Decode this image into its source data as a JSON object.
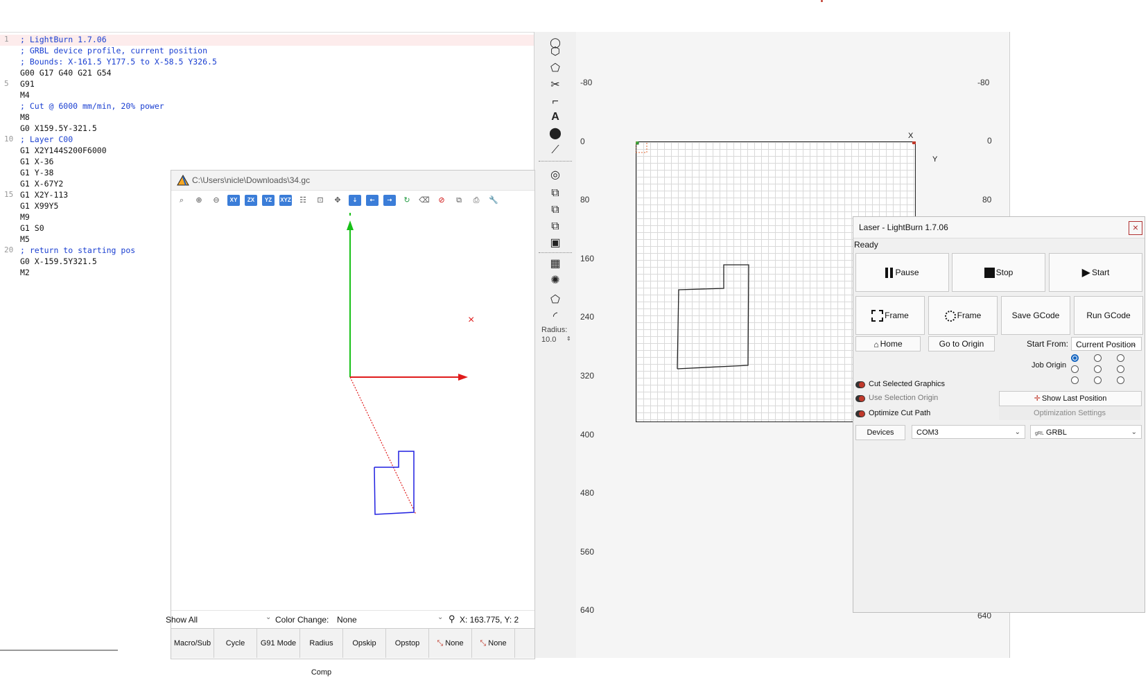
{
  "editor": {
    "lines": [
      {
        "num": "1",
        "text": "; LightBurn 1.7.06",
        "kind": "comment"
      },
      {
        "num": "",
        "text": "; GRBL device profile, current position",
        "kind": "comment"
      },
      {
        "num": "",
        "text": "; Bounds: X-161.5 Y177.5 to X-58.5 Y326.5",
        "kind": "comment"
      },
      {
        "num": "",
        "text": "G00 G17 G40 G21 G54",
        "kind": "plain"
      },
      {
        "num": "5",
        "text": "G91",
        "kind": "plain"
      },
      {
        "num": "",
        "text": "M4",
        "kind": "plain"
      },
      {
        "num": "",
        "text": "; Cut @ 6000 mm/min, 20% power",
        "kind": "comment"
      },
      {
        "num": "",
        "text": "M8",
        "kind": "plain"
      },
      {
        "num": "",
        "text": "G0 X159.5Y-321.5",
        "kind": "plain"
      },
      {
        "num": "10",
        "text": "; Layer C00",
        "kind": "comment"
      },
      {
        "num": "",
        "text": "G1 X2Y144S200F6000",
        "kind": "plain"
      },
      {
        "num": "",
        "text": "G1 X-36",
        "kind": "plain"
      },
      {
        "num": "",
        "text": "G1 Y-38",
        "kind": "plain"
      },
      {
        "num": "",
        "text": "G1 X-67Y2",
        "kind": "plain"
      },
      {
        "num": "15",
        "text": "G1 X2Y-113",
        "kind": "plain"
      },
      {
        "num": "",
        "text": "G1 X99Y5",
        "kind": "plain"
      },
      {
        "num": "",
        "text": "M9",
        "kind": "plain"
      },
      {
        "num": "",
        "text": "G1 S0",
        "kind": "plain"
      },
      {
        "num": "",
        "text": "M5",
        "kind": "plain"
      },
      {
        "num": "20",
        "text": "; return to starting pos",
        "kind": "comment"
      },
      {
        "num": "",
        "text": "G0 X-159.5Y321.5",
        "kind": "plain"
      },
      {
        "num": "",
        "text": "M2",
        "kind": "plain"
      },
      {
        "num": "",
        "text": "",
        "kind": "plain"
      }
    ]
  },
  "viewer": {
    "title": "C:\\Users\\nicle\\Downloads\\34.gc",
    "toolbar": [
      "zoom-100-icon",
      "zoom-in-icon",
      "zoom-out-icon",
      "XY",
      "ZX",
      "YZ",
      "XYZ",
      "tree-icon",
      "fit-icon",
      "pan-icon",
      "move-down-icon",
      "move-left-icon",
      "move-right-icon",
      "refresh-icon",
      "clear-icon",
      "stop-icon",
      "copy-icon",
      "print-icon",
      "wrench-icon"
    ],
    "axis_x_label": "×",
    "show_all": "Show All",
    "color_change_label": "Color Change:",
    "color_change_value": "None",
    "coords": "X: 163.775,  Y: 2",
    "tabs": [
      "Macro/Sub",
      "Cycle",
      "G91 Mode",
      "Radius Comp",
      "Opskip",
      "Opstop",
      "None",
      "None"
    ]
  },
  "tools": {
    "radius_label": "Radius:",
    "radius_value": "10.0"
  },
  "canvas": {
    "left_ruler": [
      "-80",
      "0",
      "80",
      "160",
      "240",
      "320",
      "400",
      "480",
      "560",
      "640"
    ],
    "right_ruler": [
      "-80",
      "0",
      "80",
      "640"
    ],
    "x_marker": "X",
    "y_marker": "Y"
  },
  "laser": {
    "title": "Laser - LightBurn 1.7.06",
    "close": "×",
    "status": "Ready",
    "pause": "Pause",
    "stop": "Stop",
    "start": "Start",
    "frame1": "Frame",
    "frame2": "Frame",
    "save_gcode": "Save GCode",
    "run_gcode": "Run GCode",
    "home": "Home",
    "go_to_origin": "Go to Origin",
    "start_from_label": "Start From:",
    "start_from_value": "Current Position",
    "job_origin_label": "Job Origin",
    "cut_selected": "Cut Selected Graphics",
    "use_selection_origin": "Use Selection Origin",
    "show_last_position": "Show Last Position",
    "optimize_cut_path": "Optimize Cut Path",
    "optimization_settings": "Optimization Settings",
    "devices": "Devices",
    "port": "COM3",
    "device_prefix": "gRL",
    "device": "GRBL"
  },
  "colors": {
    "comment": "#1a3fd1",
    "toggle_on": "#c0392b",
    "radio_selected": "#1565c0"
  }
}
